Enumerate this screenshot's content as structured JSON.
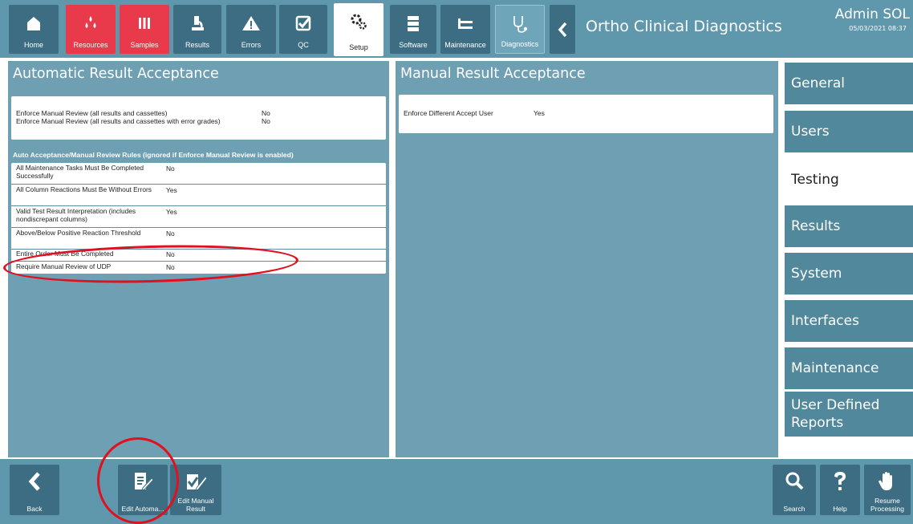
{
  "toolbar": {
    "buttons": [
      {
        "label": "Home",
        "icon": "home-icon"
      },
      {
        "label": "Resources",
        "icon": "drops-icon"
      },
      {
        "label": "Samples",
        "icon": "tubes-icon"
      },
      {
        "label": "Results",
        "icon": "microscope-icon"
      },
      {
        "label": "Errors",
        "icon": "warning-icon"
      },
      {
        "label": "QC",
        "icon": "checkbox-icon"
      },
      {
        "label": "Setup",
        "icon": "gears-icon"
      },
      {
        "label": "Software",
        "icon": "server-icon"
      },
      {
        "label": "Maintenance",
        "icon": "tools-icon"
      },
      {
        "label": "Diagnostics",
        "icon": "stethoscope-icon"
      }
    ],
    "colors": {
      "alert": "#e83a4a",
      "bar": "#5f97ac",
      "button": "#3c6d82"
    }
  },
  "header": {
    "app_title": "Ortho Clinical Diagnostics",
    "user": "Admin SOL",
    "datetime": "05/03/2021 08:37"
  },
  "auto": {
    "title": "Automatic Result Acceptance",
    "enforce": [
      {
        "label": "Enforce Manual Review (all results and cassettes)",
        "value": "No"
      },
      {
        "label": "Enforce Manual Review (all results and cassettes with error grades)",
        "value": "No"
      }
    ],
    "rules_heading": "Auto Acceptance/Manual Review Rules (ignored if Enforce Manual Review is enabled)",
    "rules": [
      {
        "label": "All Maintenance Tasks Must Be Completed Successfully",
        "value": "No"
      },
      {
        "label": "All Column Reactions Must Be Without Errors",
        "value": "Yes"
      },
      {
        "label": "Valid Test Result Interpretation (includes nondiscrepant columns)",
        "value": "Yes"
      },
      {
        "label": "Above/Below Positive Reaction Threshold",
        "value": "No"
      },
      {
        "label": "Entire Order Must Be Completed",
        "value": "No"
      },
      {
        "label": "Require Manual Review of UDP",
        "value": "No"
      }
    ]
  },
  "manual": {
    "title": "Manual Result Acceptance",
    "rows": [
      {
        "label": "Enforce Different Accept User",
        "value": "Yes"
      }
    ]
  },
  "sidenav": {
    "items": [
      "General",
      "Users",
      "Testing",
      "Results",
      "System",
      "Interfaces",
      "Maintenance",
      "User Defined Reports"
    ],
    "selected": "Testing"
  },
  "bottom": {
    "back": "Back",
    "edit_auto": "Edit Automa...",
    "edit_manual": "Edit Manual Result",
    "search": "Search",
    "help": "Help",
    "resume": "Resume Processing"
  }
}
